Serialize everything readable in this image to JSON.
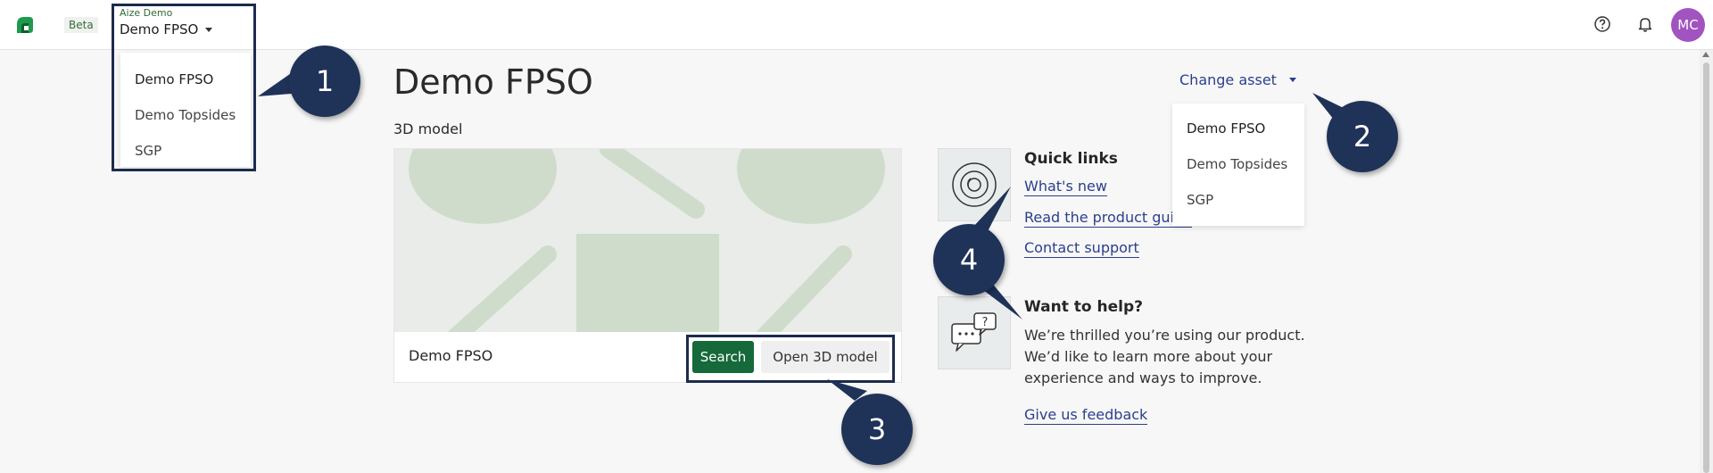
{
  "header": {
    "beta_label": "Beta",
    "org_small": "Aize Demo",
    "org_name": "Demo FPSO",
    "avatar_initials": "MC",
    "icons": [
      "help-icon",
      "bell-icon"
    ]
  },
  "org_menu": {
    "items": [
      "Demo FPSO",
      "Demo Topsides",
      "SGP"
    ]
  },
  "main": {
    "title": "Demo FPSO",
    "model_label": "3D model",
    "model_name": "Demo FPSO",
    "search_label": "Search",
    "open_model_label": "Open 3D model"
  },
  "asset_switch": {
    "label": "Change asset",
    "items": [
      "Demo FPSO",
      "Demo Topsides",
      "SGP"
    ]
  },
  "quick_links": {
    "heading": "Quick links",
    "links": [
      "What's new",
      "Read the product guide",
      "Contact support"
    ]
  },
  "help": {
    "heading": "Want to help?",
    "text": "We’re thrilled you’re using our product. We’d like to learn more about your experience and ways to improve.",
    "feedback_label": "Give us feedback"
  },
  "annotations": [
    "1",
    "2",
    "3",
    "4"
  ],
  "colors": {
    "brand_green": "#16693a",
    "link_blue": "#2b3f8c",
    "annotation_navy": "#1f3258",
    "avatar_purple": "#a154bf"
  }
}
